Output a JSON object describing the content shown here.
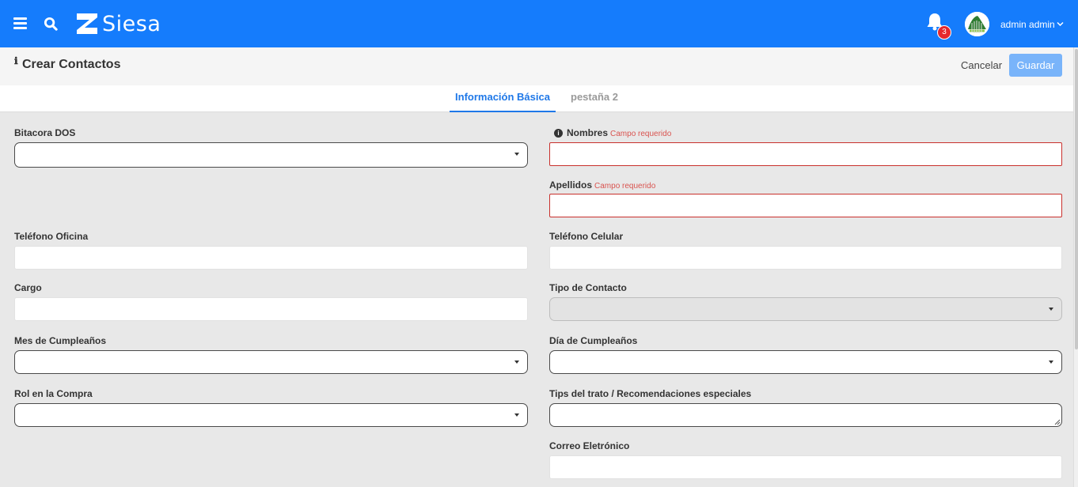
{
  "topbar": {
    "brand": "Siesa",
    "notification_count": "3",
    "user_name": "admin admin"
  },
  "header": {
    "title": "Crear Contactos",
    "cancel_label": "Cancelar",
    "save_label": "Guardar"
  },
  "tabs": [
    {
      "label": "Información Básica",
      "active": true
    },
    {
      "label": "pestaña 2",
      "active": false
    }
  ],
  "form": {
    "required_text": "Campo requerido",
    "bitacora": {
      "label": "Bitacora DOS",
      "value": ""
    },
    "nombres": {
      "label": "Nombres",
      "value": ""
    },
    "apellidos": {
      "label": "Apellidos",
      "value": ""
    },
    "telefono_oficina": {
      "label": "Teléfono Oficina",
      "value": ""
    },
    "telefono_celular": {
      "label": "Teléfono Celular",
      "value": ""
    },
    "cargo": {
      "label": "Cargo",
      "value": ""
    },
    "tipo_contacto": {
      "label": "Tipo de Contacto",
      "value": ""
    },
    "mes_cumple": {
      "label": "Mes de Cumpleaños",
      "value": ""
    },
    "dia_cumple": {
      "label": "Día de Cumpleaños",
      "value": ""
    },
    "rol_compra": {
      "label": "Rol en la Compra",
      "value": ""
    },
    "tips": {
      "label": "Tips del trato / Recomendaciones especiales",
      "value": ""
    },
    "correo": {
      "label": "Correo Eletrónico",
      "value": ""
    }
  },
  "colors": {
    "brand_blue": "#157cfc",
    "accent_blue": "#1f78e8",
    "save_button": "#79b4fa",
    "error_red": "#c9302c",
    "badge_red": "#e5282e"
  }
}
